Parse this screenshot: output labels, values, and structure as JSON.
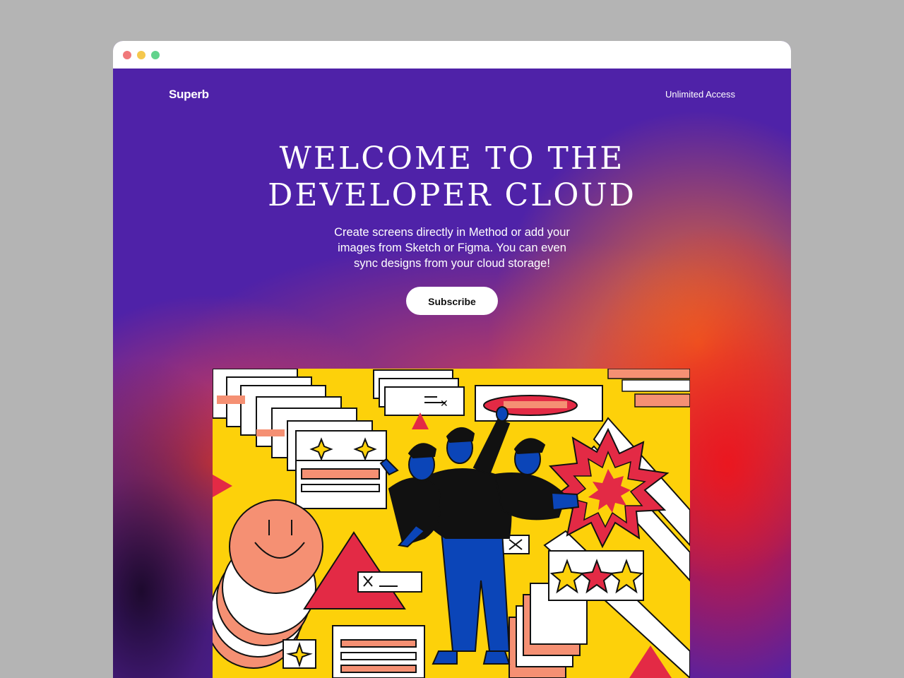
{
  "window": {
    "controls": [
      "close",
      "minimize",
      "maximize"
    ]
  },
  "nav": {
    "logo": "Superb",
    "link": "Unlimited Access"
  },
  "hero": {
    "title_line1": "WELCOME TO THE",
    "title_line2": "DEVELOPER CLOUD",
    "subtitle_line1": "Create screens directly in Method or add your",
    "subtitle_line2": "images from Sketch or Figma. You can even",
    "subtitle_line3": "sync designs from your cloud storage!",
    "cta_label": "Subscribe"
  },
  "colors": {
    "brand_purple": "#4f22a8",
    "accent_yellow": "#fdd10a",
    "accent_red": "#e32a45",
    "accent_salmon": "#f59073",
    "accent_blue": "#0b45b8"
  },
  "illustration": {
    "subject": "three-person-figure-with-ui-windows",
    "symbols": [
      "star-icon",
      "close-x-icon",
      "smiley-face-icon",
      "triangle-shape",
      "burst-shape"
    ]
  }
}
